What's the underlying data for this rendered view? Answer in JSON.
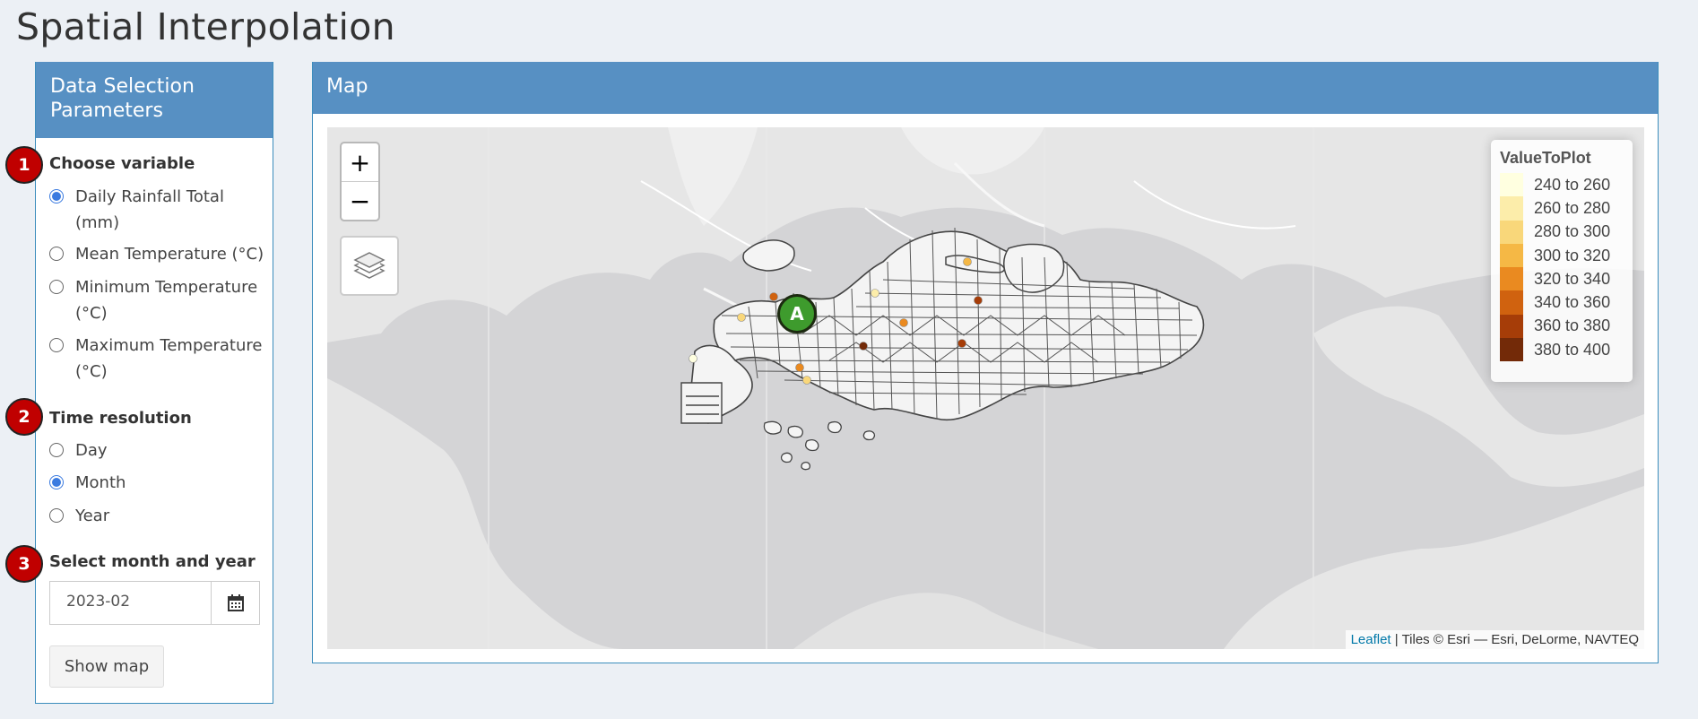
{
  "page": {
    "title": "Spatial Interpolation"
  },
  "sidebar": {
    "header": "Data Selection Parameters",
    "variable": {
      "label": "Choose variable",
      "options": [
        {
          "line1": "Daily Rainfall Total",
          "line2": "(mm)",
          "checked": true
        },
        {
          "line1": "Mean Temperature (°C)",
          "line2": "",
          "checked": false
        },
        {
          "line1": "Minimum Temperature",
          "line2": "(°C)",
          "checked": false
        },
        {
          "line1": "Maximum Temperature",
          "line2": "(°C)",
          "checked": false
        }
      ]
    },
    "resolution": {
      "label": "Time resolution",
      "options": [
        {
          "label": "Day",
          "checked": false
        },
        {
          "label": "Month",
          "checked": true
        },
        {
          "label": "Year",
          "checked": false
        }
      ]
    },
    "date": {
      "label": "Select month and year",
      "value": "2023-02",
      "icon": "calendar-icon"
    },
    "show_button": "Show map"
  },
  "steps": [
    "1",
    "2",
    "3"
  ],
  "map": {
    "header": "Map",
    "zoom_in": "+",
    "zoom_out": "−",
    "layers_icon": "layers-icon",
    "marker_label": "A",
    "marker_color": "#3e9b2d",
    "legend": {
      "title": "ValueToPlot",
      "items": [
        {
          "label": "240 to 260",
          "color": "#ffffe0"
        },
        {
          "label": "260 to 280",
          "color": "#fcedaa"
        },
        {
          "label": "280 to 300",
          "color": "#f9d77a"
        },
        {
          "label": "300 to 320",
          "color": "#f5b845"
        },
        {
          "label": "320 to 340",
          "color": "#ea8a20"
        },
        {
          "label": "340 to 360",
          "color": "#d0620f"
        },
        {
          "label": "360 to 380",
          "color": "#a63d08"
        },
        {
          "label": "380 to 400",
          "color": "#732a08"
        }
      ]
    },
    "attribution": {
      "link": "Leaflet",
      "text": " | Tiles © Esri — Esri, DeLorme, NAVTEQ"
    },
    "stations": [
      {
        "color": "#ffffe0"
      },
      {
        "color": "#f9d77a"
      },
      {
        "color": "#d0620f"
      },
      {
        "color": "#f9d77a"
      },
      {
        "color": "#fcedaa"
      },
      {
        "color": "#ea8a20"
      },
      {
        "color": "#f5b845"
      },
      {
        "color": "#a63d08"
      },
      {
        "color": "#732a08"
      },
      {
        "color": "#a63d08"
      },
      {
        "color": "#ea8a20"
      }
    ]
  }
}
